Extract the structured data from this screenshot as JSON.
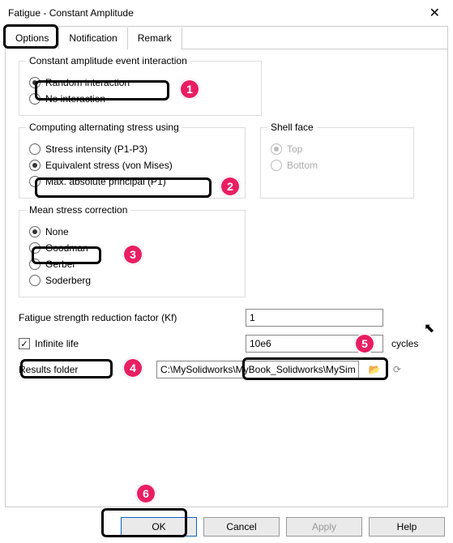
{
  "window": {
    "title": "Fatigue - Constant Amplitude"
  },
  "tabs": {
    "options": "Options",
    "notification": "Notification",
    "remark": "Remark",
    "active": "options"
  },
  "group_interaction": {
    "legend": "Constant amplitude event interaction",
    "random": "Random interaction",
    "none": "No interaction",
    "selected": "random"
  },
  "group_computing": {
    "legend": "Computing alternating stress using",
    "si": "Stress intensity (P1-P3)",
    "vm": "Equivalent stress (von Mises)",
    "map": "Max. absolute principal (P1)",
    "selected": "vm"
  },
  "group_shell": {
    "legend": "Shell face",
    "top": "Top",
    "bottom": "Bottom",
    "selected": "top",
    "disabled": true
  },
  "group_msc": {
    "legend": "Mean stress correction",
    "none": "None",
    "goodman": "Goodman",
    "gerber": "Gerber",
    "soderberg": "Soderberg",
    "selected": "none"
  },
  "kf": {
    "label": "Fatigue strength reduction factor (Kf)",
    "value": "1"
  },
  "infinite": {
    "label": "Infinite life",
    "checked": true,
    "value": "10e6",
    "unit": "cycles"
  },
  "folder": {
    "label": "Results folder",
    "value": "C:\\MySolidworks\\MyBook_Solidworks\\MySimulat"
  },
  "buttons": {
    "ok": "OK",
    "cancel": "Cancel",
    "apply": "Apply",
    "help": "Help"
  },
  "callouts": {
    "b1": "1",
    "b2": "2",
    "b3": "3",
    "b4": "4",
    "b5": "5",
    "b6": "6"
  },
  "icons": {
    "browse": "📂",
    "refresh": "⟳",
    "check": "✓",
    "cursor": "↖"
  }
}
